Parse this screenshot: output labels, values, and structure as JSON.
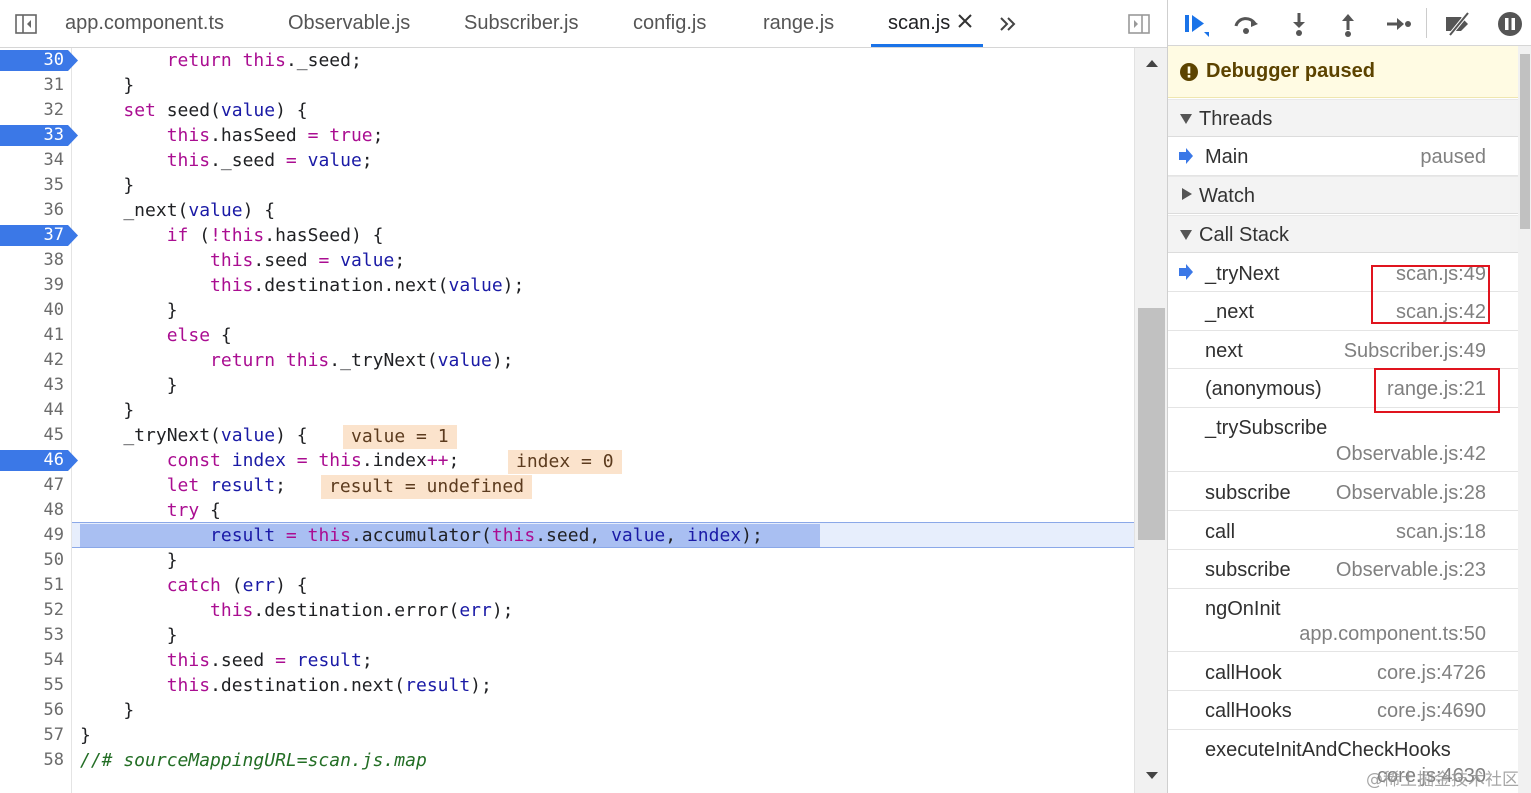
{
  "tabs": [
    {
      "label": "app.component.ts",
      "active": false
    },
    {
      "label": "Observable.js",
      "active": false
    },
    {
      "label": "Subscriber.js",
      "active": false
    },
    {
      "label": "config.js",
      "active": false
    },
    {
      "label": "range.js",
      "active": false
    },
    {
      "label": "scan.js",
      "active": true
    }
  ],
  "editor": {
    "line_numbers": [
      "30",
      "31",
      "32",
      "33",
      "34",
      "35",
      "36",
      "37",
      "38",
      "39",
      "40",
      "41",
      "42",
      "43",
      "44",
      "45",
      "46",
      "47",
      "48",
      "49",
      "50",
      "51",
      "52",
      "53",
      "54",
      "55",
      "56",
      "57",
      "58"
    ],
    "breakpoint_lines": [
      "30",
      "33",
      "37",
      "46"
    ],
    "current_line": "49",
    "inline_values": {
      "value": "value = 1",
      "index": "index = 0",
      "result": "result = undefined"
    }
  },
  "debugger": {
    "status": "Debugger paused",
    "sections": {
      "threads": "Threads",
      "watch": "Watch",
      "call_stack": "Call Stack"
    },
    "thread": {
      "name": "Main",
      "state": "paused"
    },
    "call_stack": [
      {
        "fn": "_tryNext",
        "loc": "scan.js:49",
        "current": true
      },
      {
        "fn": "_next",
        "loc": "scan.js:42"
      },
      {
        "fn": "next",
        "loc": "Subscriber.js:49"
      },
      {
        "fn": "(anonymous)",
        "loc": "range.js:21"
      },
      {
        "fn": "_trySubscribe",
        "loc": "Observable.js:42"
      },
      {
        "fn": "subscribe",
        "loc": "Observable.js:28"
      },
      {
        "fn": "call",
        "loc": "scan.js:18"
      },
      {
        "fn": "subscribe",
        "loc": "Observable.js:23"
      },
      {
        "fn": "ngOnInit",
        "loc": "app.component.ts:50"
      },
      {
        "fn": "callHook",
        "loc": "core.js:4726"
      },
      {
        "fn": "callHooks",
        "loc": "core.js:4690"
      },
      {
        "fn": "executeInitAndCheckHooks",
        "loc": "core.js:4630"
      }
    ]
  },
  "watermark": "@稀土掘金技术社区",
  "colors": {
    "breakpoint": "#3b78e7",
    "current_line": "#e7eefc",
    "keyword": "#aa0d91",
    "variable": "#1a1aa6",
    "highlight_box": "#e0141e"
  }
}
